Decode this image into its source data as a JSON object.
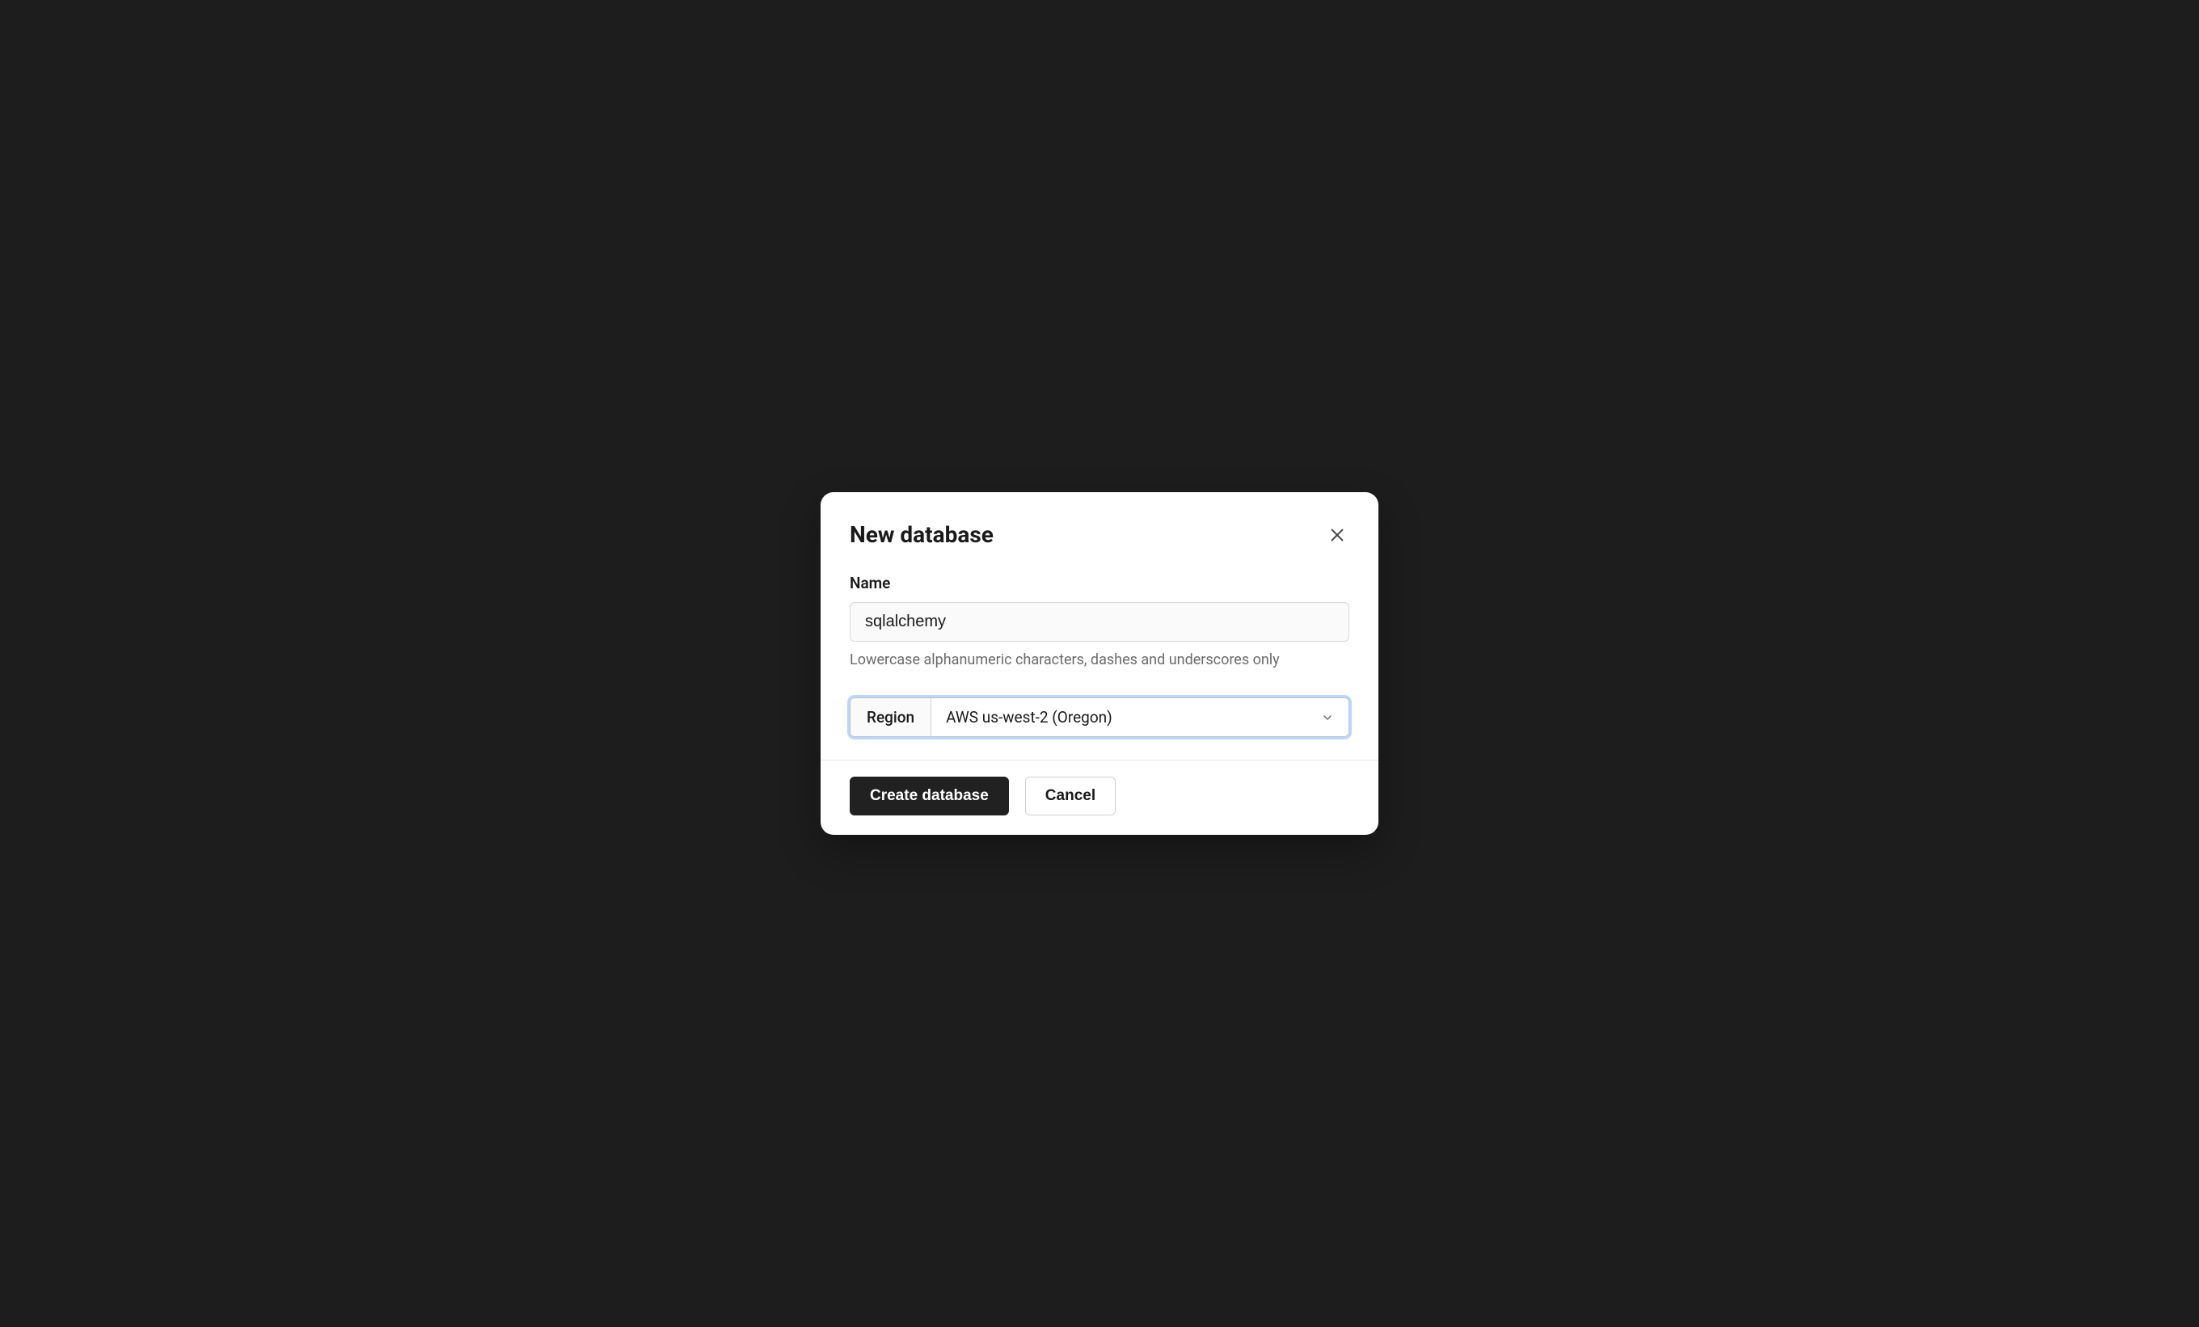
{
  "modal": {
    "title": "New database",
    "close_aria": "Close",
    "name_field": {
      "label": "Name",
      "value": "sqlalchemy",
      "placeholder": "",
      "help": "Lowercase alphanumeric characters, dashes and underscores only"
    },
    "region_field": {
      "label": "Region",
      "selected": "AWS us-west-2 (Oregon)"
    },
    "actions": {
      "primary": "Create database",
      "secondary": "Cancel"
    }
  }
}
